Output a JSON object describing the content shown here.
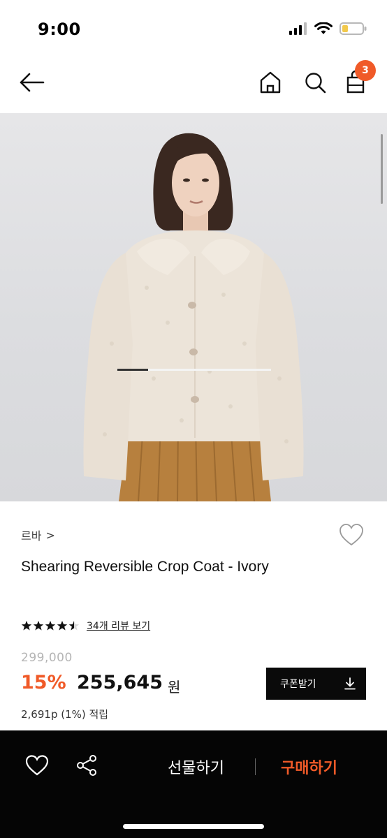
{
  "status_bar": {
    "time": "9:00"
  },
  "header": {
    "back_icon": "arrow-left-icon",
    "home_icon": "home-icon",
    "search_icon": "search-icon",
    "bag_icon": "shopping-bag-icon",
    "bag_badge": "3"
  },
  "product_image": {
    "carousel_progress": 0.2
  },
  "product": {
    "brand": "르바",
    "brand_chevron": ">",
    "title": "Shearing Reversible Crop Coat - Ivory",
    "rating": 4.5,
    "review_link": "34개 리뷰 보기",
    "original_price": "299,000",
    "discount": "15%",
    "price": "255,645",
    "currency": "원",
    "points": "2,691p (1%) 적립",
    "coupon_label": "쿠폰받기"
  },
  "bottom_bar": {
    "gift_label": "선물하기",
    "buy_label": "구매하기"
  },
  "colors": {
    "accent": "#f05a28",
    "dark": "#050505"
  }
}
